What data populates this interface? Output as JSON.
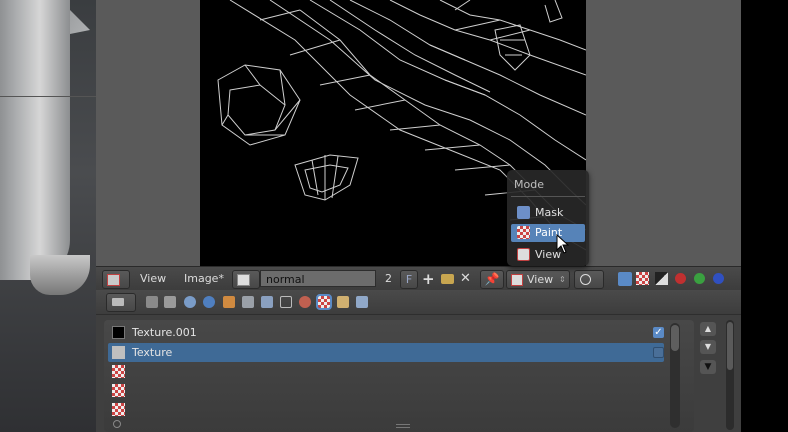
{
  "image_header": {
    "view_menu": "View",
    "image_menu": "Image*",
    "image_name": "normal",
    "users_count": "2",
    "fake_user": "F",
    "mode_select": "View"
  },
  "mode_menu": {
    "title": "Mode",
    "items": [
      {
        "label": "Mask",
        "icon": "mask-icon",
        "selected": false
      },
      {
        "label": "Paint",
        "icon": "paint-icon",
        "selected": true
      },
      {
        "label": "View",
        "icon": "view-icon",
        "selected": false
      }
    ]
  },
  "texture_slots": [
    {
      "label": "Texture.001",
      "checked": true,
      "swatch": "#000000"
    },
    {
      "label": "Texture",
      "checked": false,
      "selected": true,
      "swatch": "#bfbfbf"
    },
    {
      "label": "",
      "swatch": "checker"
    },
    {
      "label": "",
      "swatch": "checker"
    },
    {
      "label": "",
      "swatch": "checker"
    }
  ],
  "colors": {
    "selected_row": "#3f6a96",
    "menu_highlight": "#5683b8",
    "accent_blue": "#5a8ac6"
  }
}
